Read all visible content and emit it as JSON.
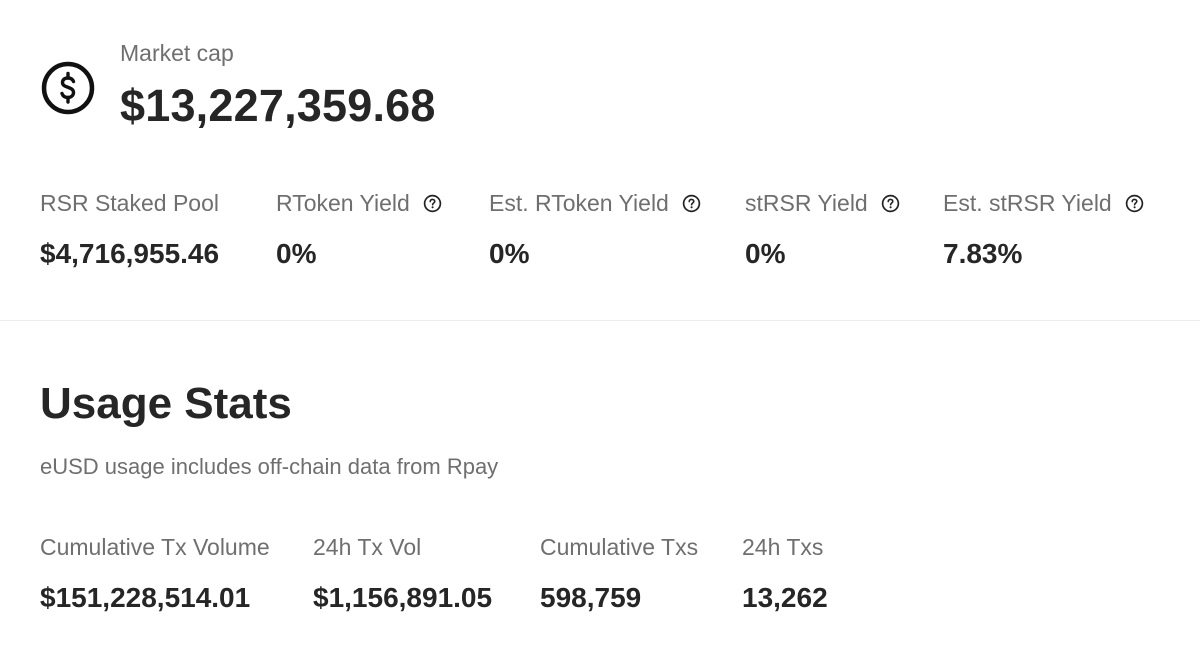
{
  "market_cap": {
    "label": "Market cap",
    "value": "$13,227,359.68",
    "icon": "dollar-circle-icon"
  },
  "token_stats": [
    {
      "label": "RSR Staked Pool",
      "value": "$4,716,955.46",
      "has_help": false
    },
    {
      "label": "RToken Yield",
      "value": "0%",
      "has_help": true
    },
    {
      "label": "Est. RToken Yield",
      "value": "0%",
      "has_help": true
    },
    {
      "label": "stRSR Yield",
      "value": "0%",
      "has_help": true
    },
    {
      "label": "Est. stRSR Yield",
      "value": "7.83%",
      "has_help": true
    }
  ],
  "usage": {
    "title": "Usage Stats",
    "description": "eUSD usage includes off-chain data from Rpay",
    "stats": [
      {
        "label": "Cumulative Tx Volume",
        "value": "$151,228,514.01"
      },
      {
        "label": "24h Tx Vol",
        "value": "$1,156,891.05"
      },
      {
        "label": "Cumulative Txs",
        "value": "598,759"
      },
      {
        "label": "24h Txs",
        "value": "13,262"
      }
    ]
  },
  "colors": {
    "label": "#6f6f6f",
    "value": "#262626",
    "divider": "#ececec"
  }
}
